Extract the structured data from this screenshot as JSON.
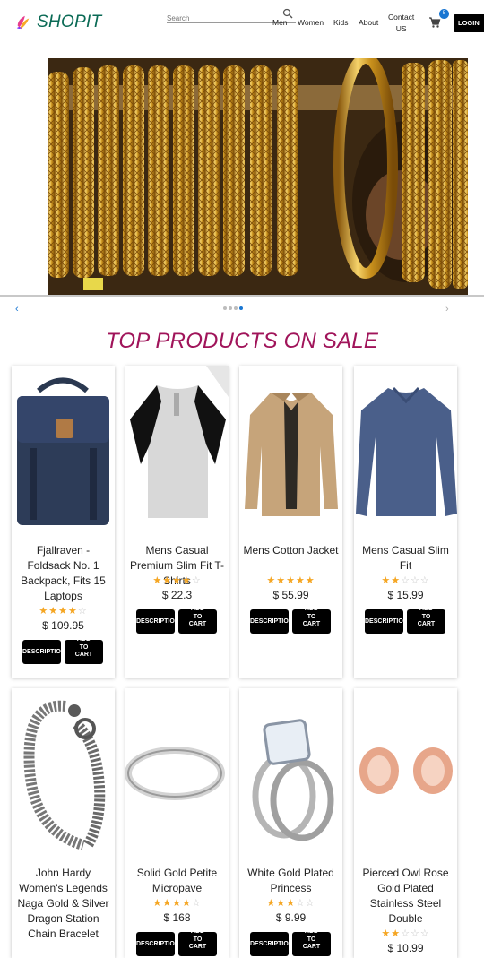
{
  "header": {
    "brand": "SHOPIT",
    "search_placeholder": "Search",
    "nav": [
      "Men",
      "Women",
      "Kids",
      "About"
    ],
    "contact": [
      "Contact",
      "US"
    ],
    "cart_count": "5",
    "login_label": "LOGIN"
  },
  "carousel": {
    "prev_label": "‹",
    "next_label": "›",
    "total_dots": 4,
    "active_dot": 4
  },
  "section_title": "TOP PRODUCTS ON SALE",
  "buttons": {
    "description": "DESCRIPTION",
    "add_to_cart": [
      "ADD",
      "TO",
      "CART"
    ]
  },
  "products": [
    {
      "title": "Fjallraven - Foldsack No. 1 Backpack, Fits 15 Laptops",
      "rating": 4,
      "price": "$ 109.95",
      "icon": "backpack"
    },
    {
      "title": "Mens Casual Premium Slim Fit T-Shirts",
      "rating": 4,
      "price": "$ 22.3",
      "icon": "raglan-tshirt"
    },
    {
      "title": "Mens Cotton Jacket",
      "rating": 5,
      "price": "$ 55.99",
      "icon": "jacket"
    },
    {
      "title": "Mens Casual Slim Fit",
      "rating": 2,
      "price": "$ 15.99",
      "icon": "long-sleeve-shirt"
    },
    {
      "title": "John Hardy Women's Legends Naga Gold & Silver Dragon Station Chain Bracelet",
      "rating": 0,
      "price": "",
      "icon": "chain-bracelet"
    },
    {
      "title": "Solid Gold Petite Micropave",
      "rating": 4,
      "price": "$ 168",
      "icon": "band-ring"
    },
    {
      "title": "White Gold Plated Princess",
      "rating": 3,
      "price": "$ 9.99",
      "icon": "diamond-ring"
    },
    {
      "title": "Pierced Owl Rose Gold Plated Stainless Steel Double",
      "rating": 2,
      "price": "$ 10.99",
      "icon": "rose-gold-plugs"
    }
  ],
  "colors": {
    "brand": "#0a6a55",
    "accent": "#1976d2",
    "title": "#a0145a",
    "star": "#f5a623"
  }
}
